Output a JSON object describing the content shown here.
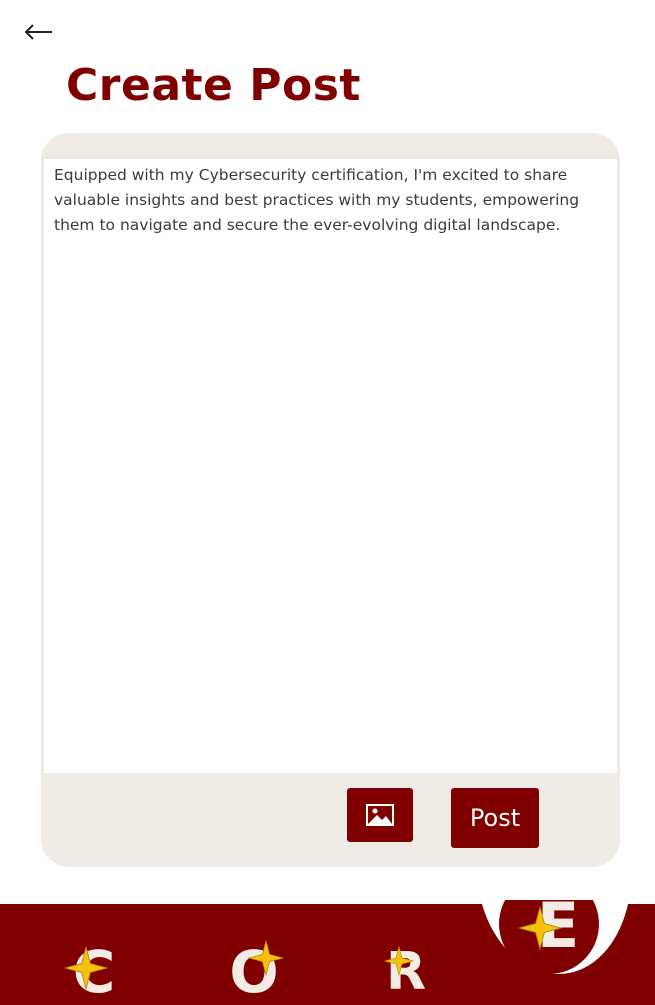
{
  "header": {
    "back_icon": "arrow-left-icon",
    "title": "Create Post"
  },
  "composer": {
    "text": "Equipped with my Cybersecurity certification, I'm excited to share valuable insights and best practices with my students, empowering them to navigate and secure the ever-evolving digital landscape.",
    "image_button_icon": "image-icon",
    "post_label": "Post"
  },
  "bottom_nav": {
    "items": [
      {
        "letter": "C",
        "icon": "sparkle-icon"
      },
      {
        "letter": "O",
        "icon": "sparkle-icon"
      },
      {
        "letter": "R",
        "icon": "sparkle-icon"
      },
      {
        "letter": "E",
        "icon": "sparkle-icon",
        "active": true
      }
    ]
  },
  "colors": {
    "brand": "#800000",
    "card_background": "#f0ebe5",
    "sparkle": "#f4c20d",
    "letter": "#f3ece4"
  }
}
